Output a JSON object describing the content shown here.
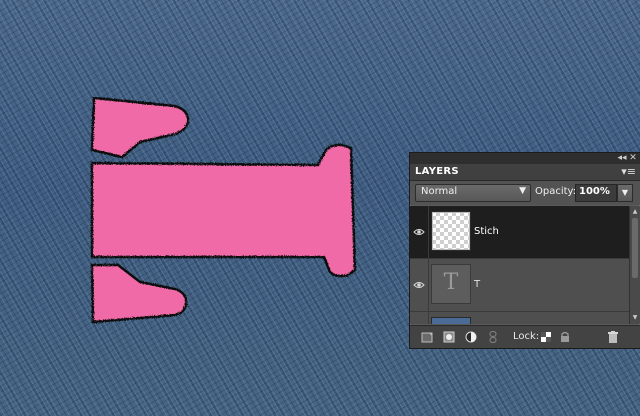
{
  "layers_panel": {
    "title": "LAYERS",
    "blend_mode": {
      "value": "Normal"
    },
    "opacity": {
      "label": "Opacity:",
      "value": "100%"
    },
    "layers": [
      {
        "name": "Stich",
        "visible": true,
        "selected": true,
        "thumbnail": "transparent-checker"
      },
      {
        "name": "T",
        "visible": true,
        "selected": false,
        "thumbnail": "type-layer"
      },
      {
        "name": "",
        "visible": true,
        "selected": false,
        "thumbnail": "denim-image"
      }
    ],
    "lock_label": "Lock:",
    "icons": {
      "collapse": "double-chevron-icon",
      "close": "close-icon",
      "menu": "panel-menu-icon",
      "new_layer": "new-layer-icon",
      "adjustment": "adjustment-layer-icon",
      "mask": "layer-mask-icon",
      "link": "link-layers-icon",
      "lock_transparent": "lock-transparent-pixels-icon",
      "lock_all": "lock-all-icon",
      "delete": "trash-icon"
    }
  },
  "canvas": {
    "subject": "pink stitched letter T on denim",
    "colors": {
      "letter_fill": "#f06aa8",
      "stitch": "#111111",
      "denim": "#46658a"
    }
  }
}
